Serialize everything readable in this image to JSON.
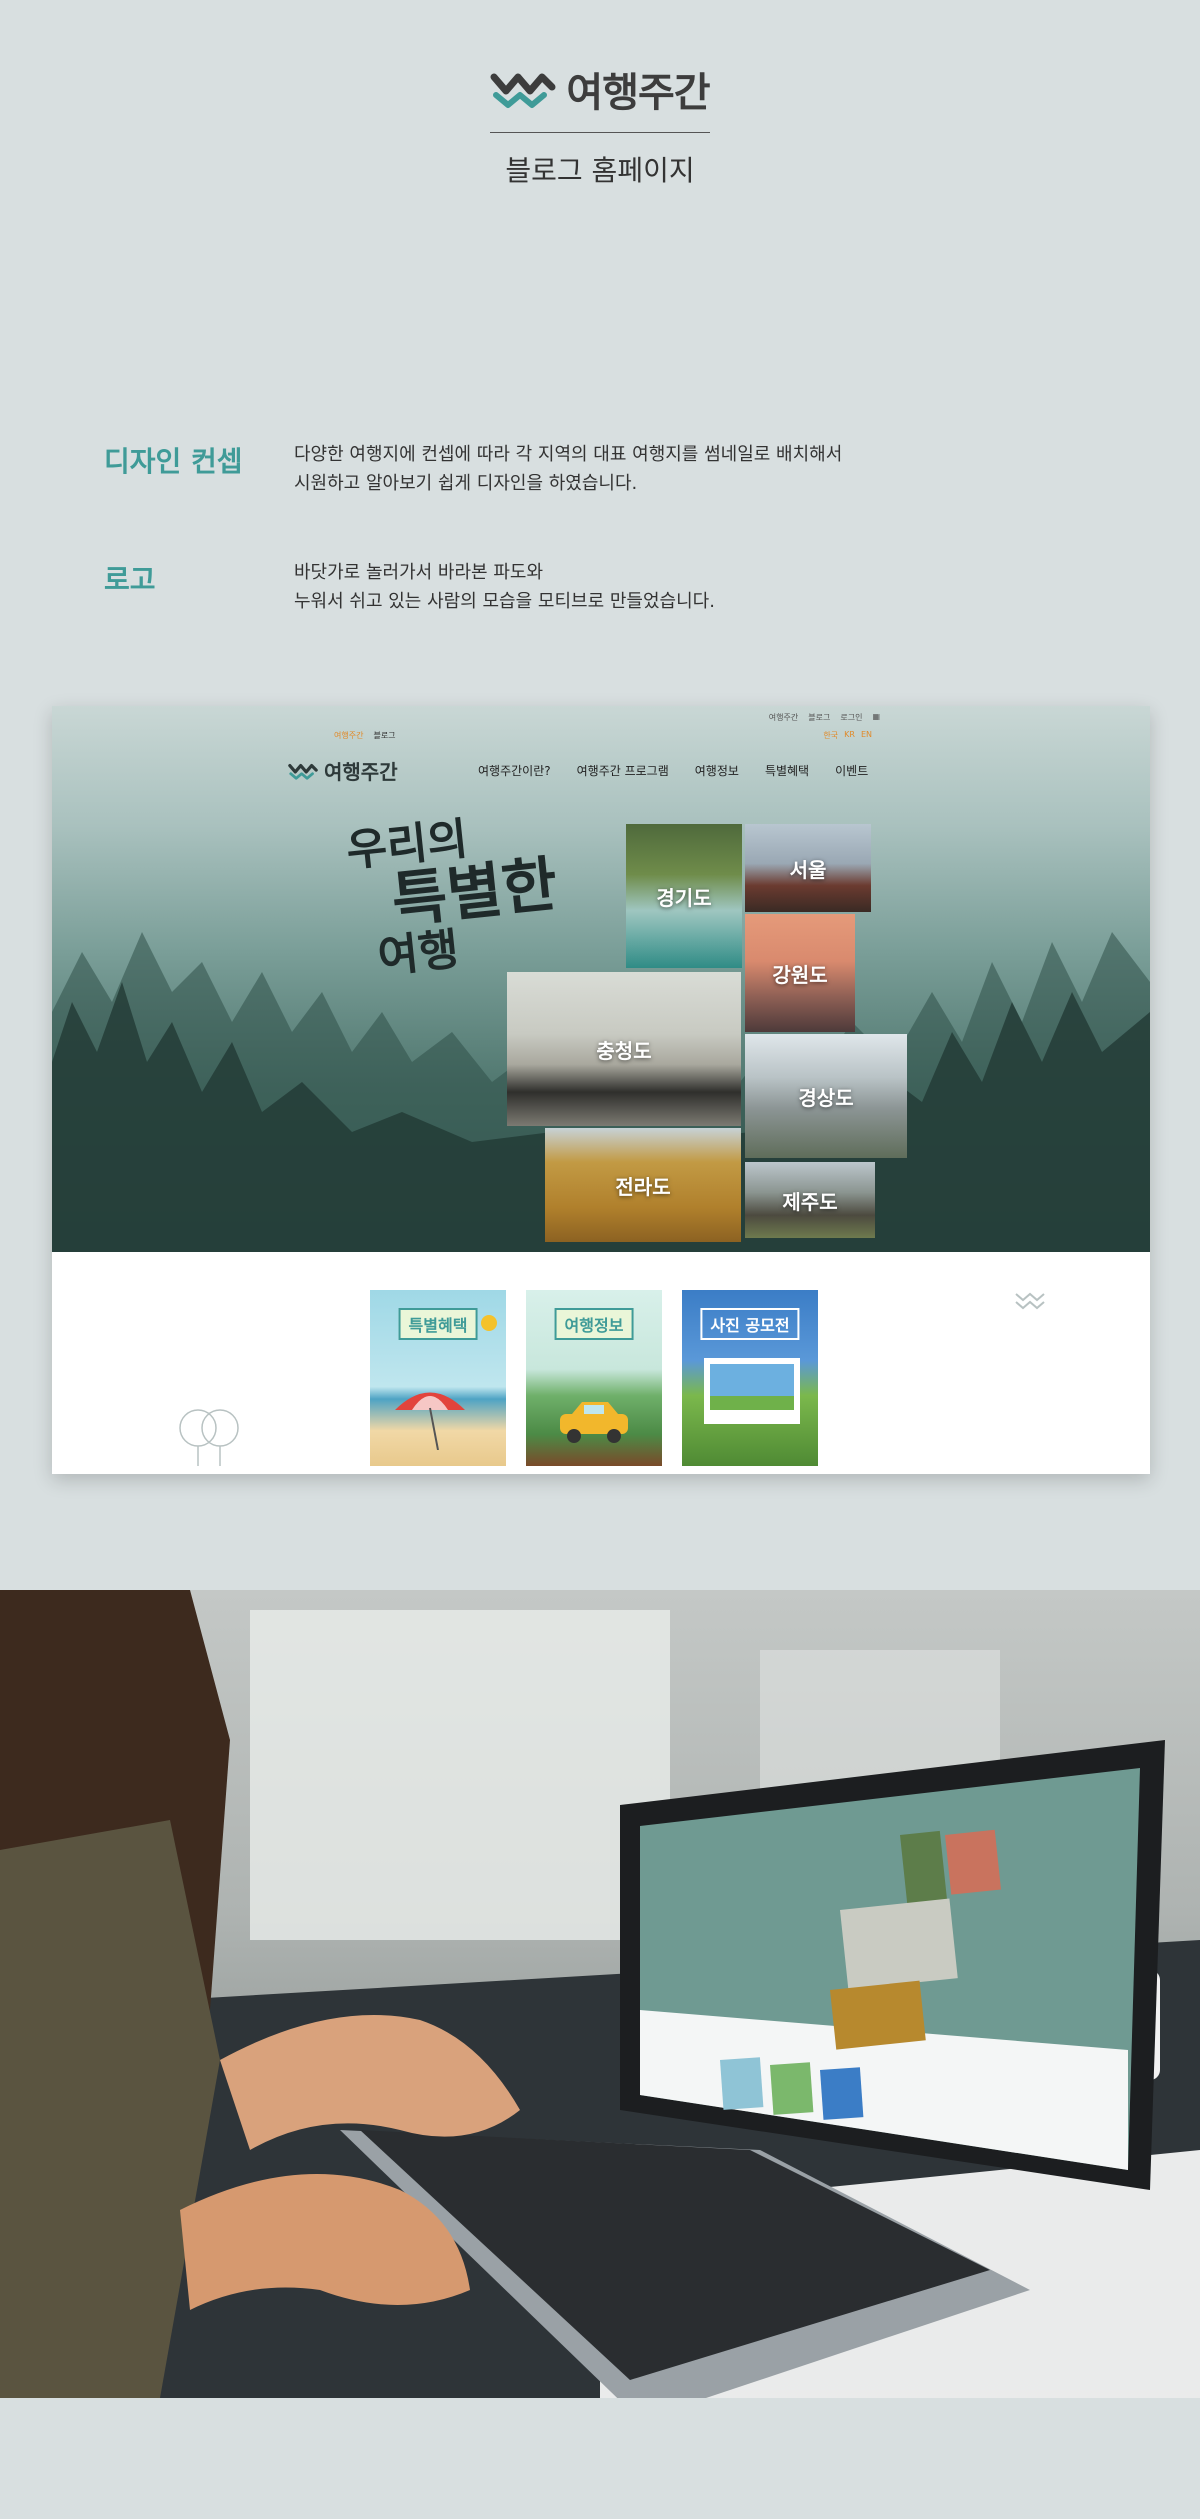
{
  "header": {
    "brand": "여행주간",
    "subtitle": "블로그 홈페이지"
  },
  "concept": {
    "heading": "디자인 컨셉",
    "lines": [
      "다양한 여행지에 컨셉에 따라  각 지역의 대표 여행지를 썸네일로 배치해서",
      "시원하고 알아보기 쉽게 디자인을 하였습니다."
    ]
  },
  "logo_section": {
    "heading": "로고",
    "lines": [
      "바닷가로 놀러가서 바라본 파도와",
      "누워서 쉬고 있는 사람의 모습을 모티브로 만들었습니다."
    ]
  },
  "site": {
    "top_tabs": [
      "여행주간",
      "블로그"
    ],
    "top_links": [
      "여행주간",
      "블로그",
      "로그인"
    ],
    "top_right_links": [
      "한국",
      "KR",
      "EN"
    ],
    "logo": "여행주간",
    "nav": [
      "여행주간이란?",
      "여행주간 프로그램",
      "여행정보",
      "특별혜택",
      "이벤트"
    ],
    "hero_title": [
      "우리의",
      "특별한",
      "여행"
    ],
    "regions": [
      "경기도",
      "서울",
      "강원도",
      "충청도",
      "경상도",
      "전라도",
      "제주도"
    ],
    "cards": [
      "특별혜택",
      "여행정보",
      "사진 공모전"
    ]
  },
  "colors": {
    "accent": "#3f9b98",
    "background": "#d8dfe0",
    "orange": "#e08a2a"
  },
  "icons": [
    "logo-wave-icon",
    "zigzag-icon",
    "tree-icon"
  ]
}
